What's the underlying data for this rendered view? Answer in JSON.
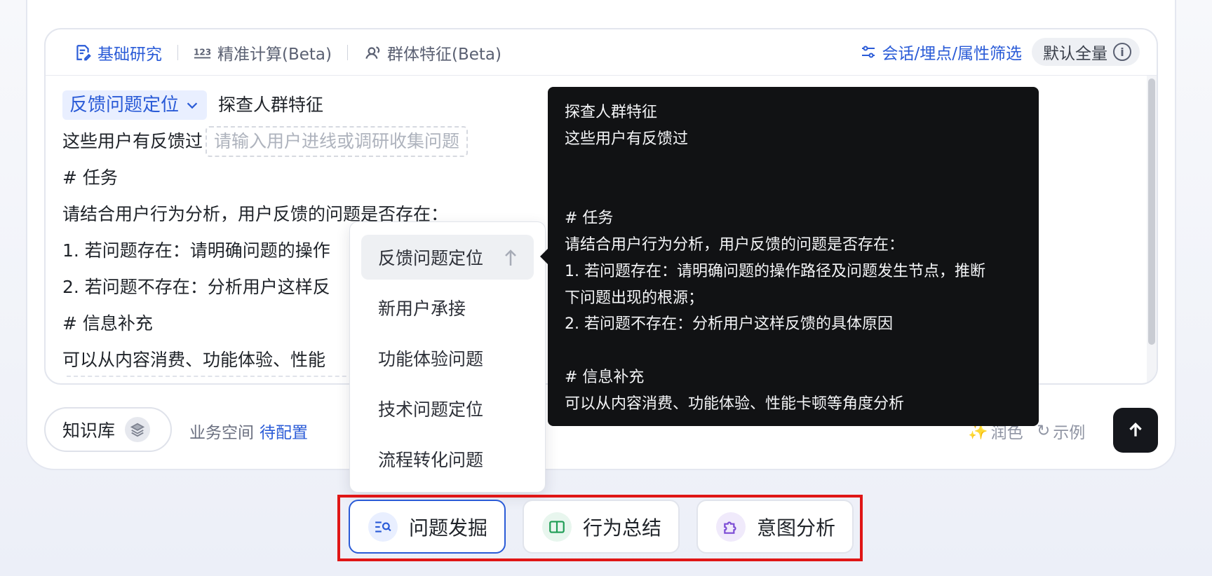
{
  "mode_bar": {
    "tabs": [
      {
        "label": "基础研究",
        "icon": "document-edit-icon",
        "active": true
      },
      {
        "label": "精准计算(Beta)",
        "icon": "numbers-123-icon",
        "active": false
      },
      {
        "label": "群体特征(Beta)",
        "icon": "user-group-icon",
        "active": false
      }
    ],
    "filter_label": "会话/埋点/属性筛选",
    "default_label": "默认全量"
  },
  "editor": {
    "template_select": "反馈问题定位",
    "title_text": "探查人群特征",
    "line2_prefix": "这些用户有反馈过",
    "line2_placeholder": "请输入用户进线或调研收集问题",
    "line3": "# 任务",
    "line4": "请结合用户行为分析，用户反馈的问题是否存在：",
    "line5": "1. 若问题存在：请明确问题的操作",
    "line6": "2. 若问题不存在：分析用户这样反",
    "line7": "# 信息补充",
    "line8": "可以从内容消费、功能体验、性能"
  },
  "dropdown": {
    "items": [
      "反馈问题定位",
      "新用户承接",
      "功能体验问题",
      "技术问题定位",
      "流程转化问题"
    ],
    "selected_index": 0
  },
  "tooltip": {
    "lines": [
      "探查人群特征",
      "这些用户有反馈过",
      "",
      "",
      "# 任务",
      "请结合用户行为分析，用户反馈的问题是否存在：",
      "1. 若问题存在：请明确问题的操作路径及问题发生节点，推断",
      "下问题出现的根源；",
      "2. 若问题不存在：分析用户这样反馈的具体原因",
      "",
      "# 信息补充",
      "可以从内容消费、功能体验、性能卡顿等角度分析"
    ]
  },
  "footer": {
    "kb_label": "知识库",
    "biz_space_label": "业务空间",
    "biz_space_link": "待配置",
    "polish_label": "润色",
    "example_label": "示例"
  },
  "shortcuts": [
    {
      "label": "问题发掘",
      "icon": "search-list-icon",
      "active": true,
      "color": "#2a5bd7",
      "bg": "#e9efff"
    },
    {
      "label": "行为总结",
      "icon": "book-split-icon",
      "active": false,
      "color": "#1f9d55",
      "bg": "#e8f6ee"
    },
    {
      "label": "意图分析",
      "icon": "puzzle-icon",
      "active": false,
      "color": "#7b4bd4",
      "bg": "#f0eafb"
    }
  ]
}
